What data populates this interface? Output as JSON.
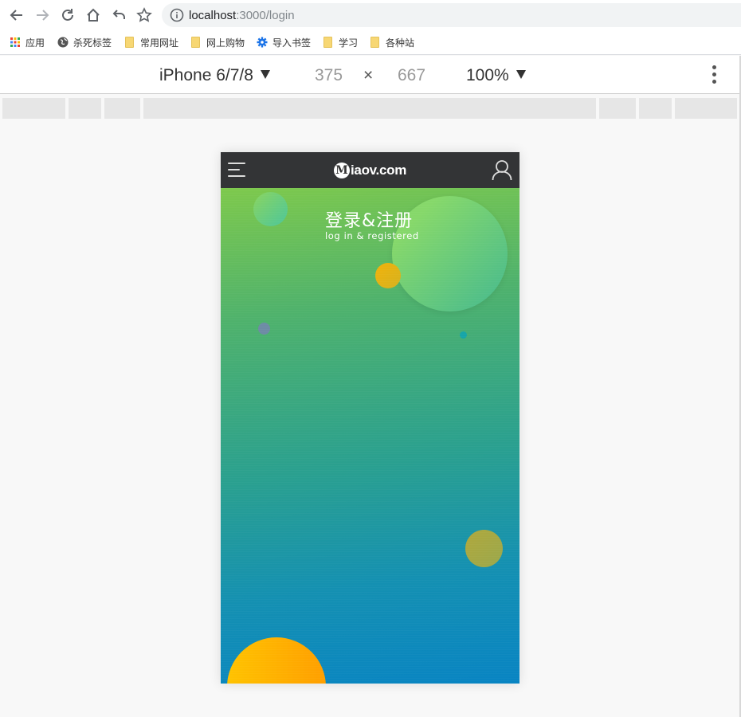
{
  "browser": {
    "url_host": "localhost",
    "url_path": ":3000/login"
  },
  "bookmarks": [
    {
      "label": "应用",
      "icon": "apps-grid-icon"
    },
    {
      "label": "杀死标签",
      "icon": "globe-icon"
    },
    {
      "label": "常用网址",
      "icon": "folder-icon"
    },
    {
      "label": "网上购物",
      "icon": "folder-icon"
    },
    {
      "label": "导入书签",
      "icon": "gear-icon"
    },
    {
      "label": "学习",
      "icon": "folder-icon"
    },
    {
      "label": "各种站",
      "icon": "folder-icon"
    }
  ],
  "device_toolbar": {
    "device": "iPhone 6/7/8",
    "width": "375",
    "times": "×",
    "height": "667",
    "zoom": "100%"
  },
  "app": {
    "logo_badge": "M",
    "logo_text": "iaov.com",
    "title": "登录&注册",
    "subtitle": "log in & registered"
  },
  "colors": {
    "header_bg": "#333436",
    "gradient_top": "#7ec94c",
    "gradient_bottom": "#0884c3"
  }
}
